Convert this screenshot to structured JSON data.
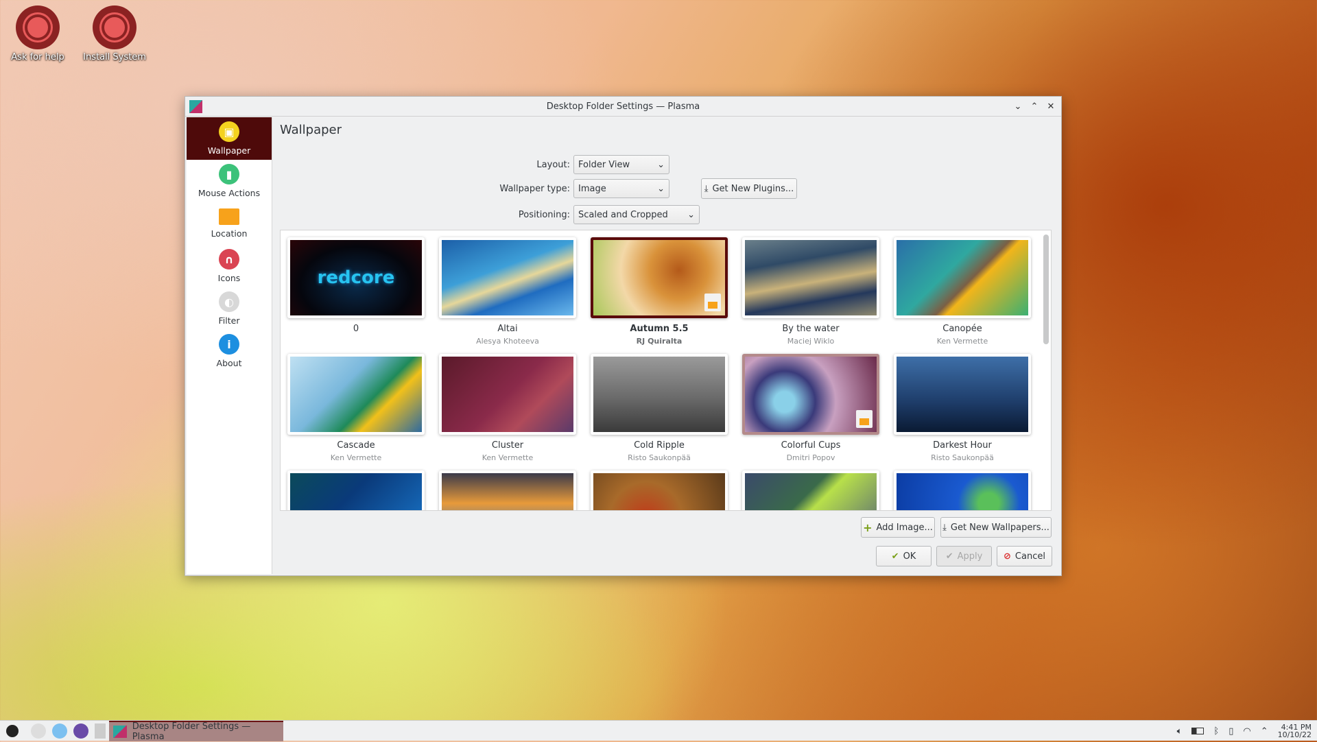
{
  "desktop": {
    "icons": [
      {
        "label": "Ask for help"
      },
      {
        "label": "Install System"
      }
    ]
  },
  "window": {
    "title": "Desktop Folder Settings — Plasma",
    "controls": {
      "minimize": "⌄",
      "maximize": "⌃",
      "close": "✕"
    }
  },
  "sidebar": {
    "items": [
      {
        "label": "Wallpaper",
        "color": "#f4d21f",
        "glyph": "▣"
      },
      {
        "label": "Mouse Actions",
        "color": "#3cc27a",
        "glyph": "▮"
      },
      {
        "label": "Location",
        "color": "#f7a21b",
        "glyph": ""
      },
      {
        "label": "Icons",
        "color": "#da4453",
        "glyph": "∩"
      },
      {
        "label": "Filter",
        "color": "#d8d8d8",
        "glyph": "◐"
      },
      {
        "label": "About",
        "color": "#1d8fe0",
        "glyph": "i"
      }
    ]
  },
  "main": {
    "heading": "Wallpaper",
    "layout_label": "Layout:",
    "layout_value": "Folder View",
    "type_label": "Wallpaper type:",
    "type_value": "Image",
    "get_plugins": "Get New Plugins...",
    "positioning_label": "Positioning:",
    "positioning_value": "Scaled and Cropped",
    "wallpapers": [
      {
        "name": "0",
        "author": ""
      },
      {
        "name": "Altai",
        "author": "Alesya Khoteeva"
      },
      {
        "name": "Autumn 5.5",
        "author": "RJ Quiralta",
        "selected": true
      },
      {
        "name": "By the water",
        "author": "Maciej Wiklo"
      },
      {
        "name": "Canopée",
        "author": "Ken Vermette"
      },
      {
        "name": "Cascade",
        "author": "Ken Vermette"
      },
      {
        "name": "Cluster",
        "author": "Ken Vermette"
      },
      {
        "name": "Cold Ripple",
        "author": "Risto Saukonpää"
      },
      {
        "name": "Colorful Cups",
        "author": "Dmitri Popov",
        "hovered": true
      },
      {
        "name": "Darkest Hour",
        "author": "Risto Saukonpää"
      },
      {
        "name": "",
        "author": ""
      },
      {
        "name": "",
        "author": ""
      },
      {
        "name": "",
        "author": ""
      },
      {
        "name": "",
        "author": ""
      },
      {
        "name": "",
        "author": ""
      }
    ],
    "thumb0_text": "redcore",
    "add_image": "Add Image...",
    "get_wallpapers": "Get New Wallpapers...",
    "ok": "OK",
    "apply": "Apply",
    "cancel": "Cancel"
  },
  "taskbar": {
    "task_label": "Desktop Folder Settings — Plasma",
    "time": "4:41 PM",
    "date": "10/10/22"
  }
}
